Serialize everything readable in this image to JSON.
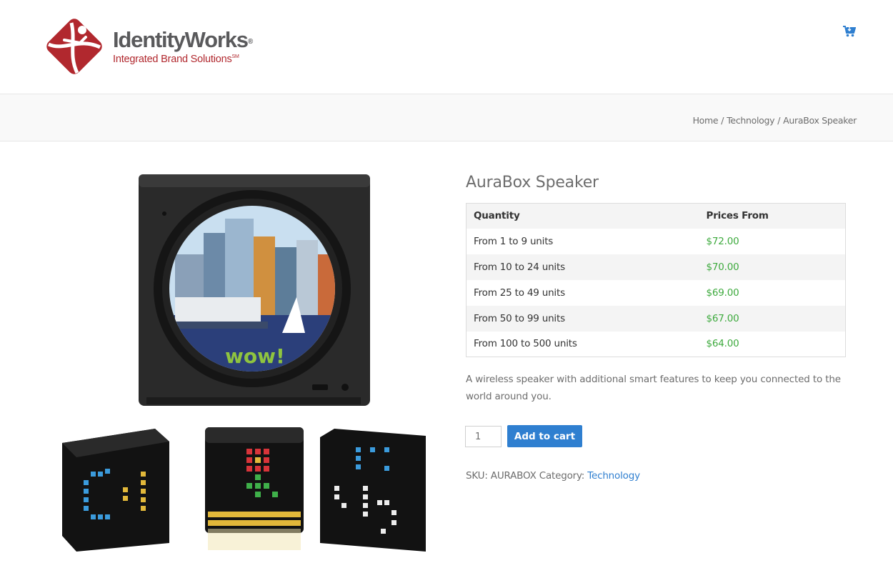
{
  "brand": {
    "name": "IdentityWorks",
    "registered_mark": "®",
    "tagline": "Integrated Brand Solutions",
    "service_mark": "SM",
    "primary_color": "#b1282e"
  },
  "header": {
    "cart_icon": "shopping-cart-icon",
    "cart_color": "#2f7fd0"
  },
  "breadcrumb": {
    "items": [
      "Home",
      "Technology",
      "AuraBox Speaker"
    ],
    "separator": "/"
  },
  "product": {
    "title": "AuraBox Speaker",
    "price_table": {
      "headers": [
        "Quantity",
        "Prices From"
      ],
      "rows": [
        {
          "quantity": "From 1 to 9 units",
          "price": "$72.00"
        },
        {
          "quantity": "From 10 to 24 units",
          "price": "$70.00"
        },
        {
          "quantity": "From 25 to 49 units",
          "price": "$69.00"
        },
        {
          "quantity": "From 50 to 99 units",
          "price": "$67.00"
        },
        {
          "quantity": "From 100 to 500 units",
          "price": "$64.00"
        }
      ]
    },
    "description": "A wireless speaker with additional smart features to keep you connected to the world around you.",
    "quantity_value": "1",
    "add_to_cart_label": "Add to cart",
    "sku_label": "SKU:",
    "sku": "AURABOX",
    "category_label": "Category:",
    "category": "Technology",
    "main_image_text": "wow!"
  },
  "colors": {
    "price": "#3eaa3e",
    "link": "#2f7fd0",
    "button": "#2f7fd0"
  }
}
